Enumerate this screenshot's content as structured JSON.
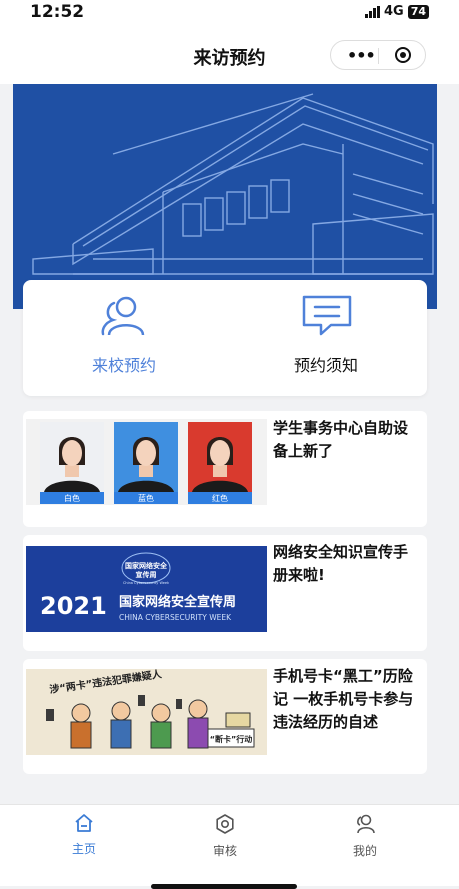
{
  "status_bar": {
    "time": "12:52",
    "network": "4G",
    "battery": "74"
  },
  "nav": {
    "title": "来访预约",
    "more_icon": "more-dots-icon",
    "close_icon": "target-icon"
  },
  "quick_actions": [
    {
      "label": "来校预约",
      "icon": "user-icon",
      "color": "#4f81d9"
    },
    {
      "label": "预约须知",
      "icon": "message-icon",
      "color": "#4f81d9"
    }
  ],
  "news": [
    {
      "title": "学生事务中心自助设备上新了",
      "photo_labels": [
        "白色",
        "蓝色",
        "红色"
      ]
    },
    {
      "title": "网络安全知识宣传手册来啦!",
      "banner_year": "2021",
      "banner_title": "国家网络安全宣传周",
      "banner_subtitle": "CHINA CYBERSECURITY WEEK",
      "banner_badge_line1": "国家网络安全",
      "banner_badge_line2": "宣传周",
      "banner_badge_en": "China Cybersecurity Week"
    },
    {
      "title": "手机号卡“黑工”历险记 一枚手机号卡参与违法经历的自述",
      "comic_caption": "涉“两卡”违法犯罪嫌疑人",
      "comic_tag": "“断卡”行动"
    }
  ],
  "tabbar": [
    {
      "label": "主页",
      "icon": "home-icon",
      "active": true
    },
    {
      "label": "审核",
      "icon": "settings-icon",
      "active": false
    },
    {
      "label": "我的",
      "icon": "profile-icon",
      "active": false
    }
  ],
  "colors": {
    "accent": "#3a7bd5",
    "banner_bg": "#1f50a4"
  }
}
